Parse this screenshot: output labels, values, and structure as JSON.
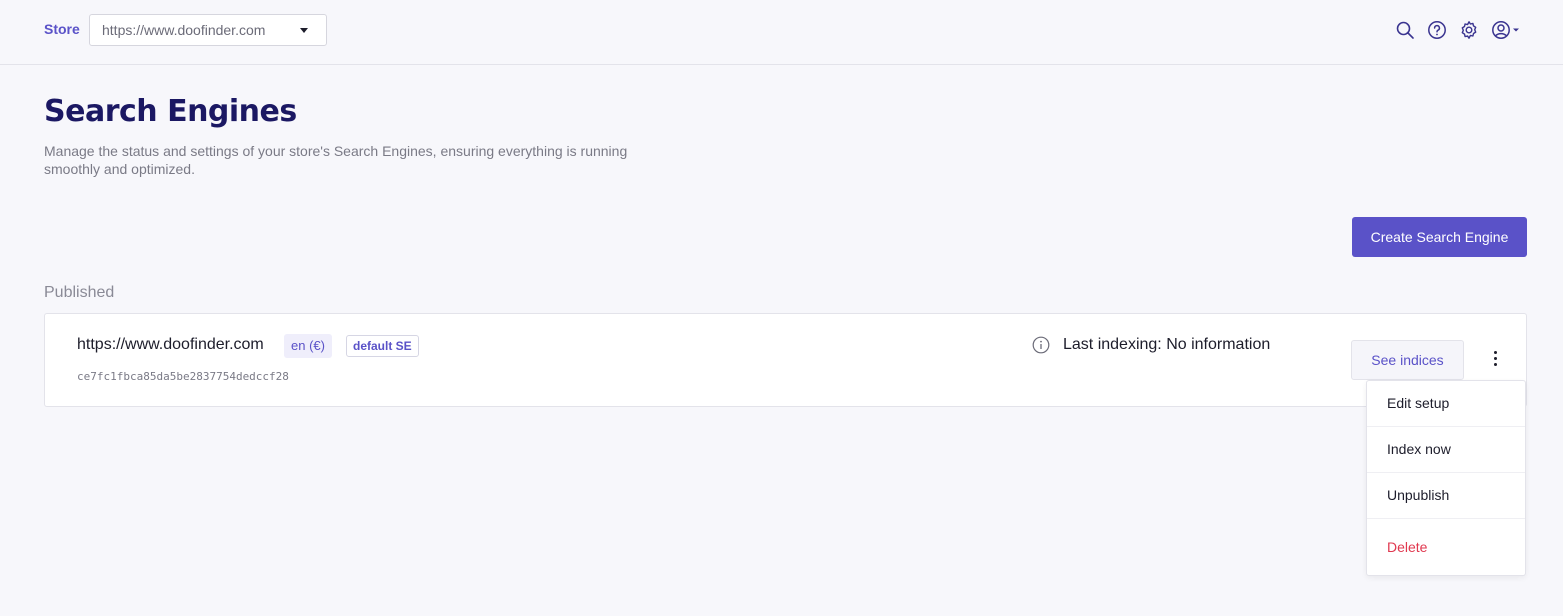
{
  "header": {
    "store_label": "Store",
    "store_select_value": "https://www.doofinder.com",
    "icons": [
      "search-icon",
      "help-icon",
      "gear-icon",
      "user-icon"
    ]
  },
  "page": {
    "title": "Search Engines",
    "description": "Manage the status and settings of your store's Search Engines, ensuring everything is running smoothly and optimized.",
    "create_button": "Create Search Engine",
    "section_label": "Published"
  },
  "engine": {
    "url": "https://www.doofinder.com",
    "language_badge": "en (€)",
    "default_badge": "default SE",
    "hash": "ce7fc1fbca85da5be2837754dedccf28",
    "indexing_label": "Last indexing:",
    "indexing_value": "No information",
    "see_indices_button": "See indices"
  },
  "menu": {
    "items": [
      {
        "label": "Edit setup"
      },
      {
        "label": "Index now"
      },
      {
        "label": "Unpublish"
      },
      {
        "label": "Delete"
      }
    ]
  },
  "colors": {
    "accent": "#5a52c8",
    "title": "#1b1863",
    "danger": "#e0384f",
    "background": "#f7f7fb"
  }
}
